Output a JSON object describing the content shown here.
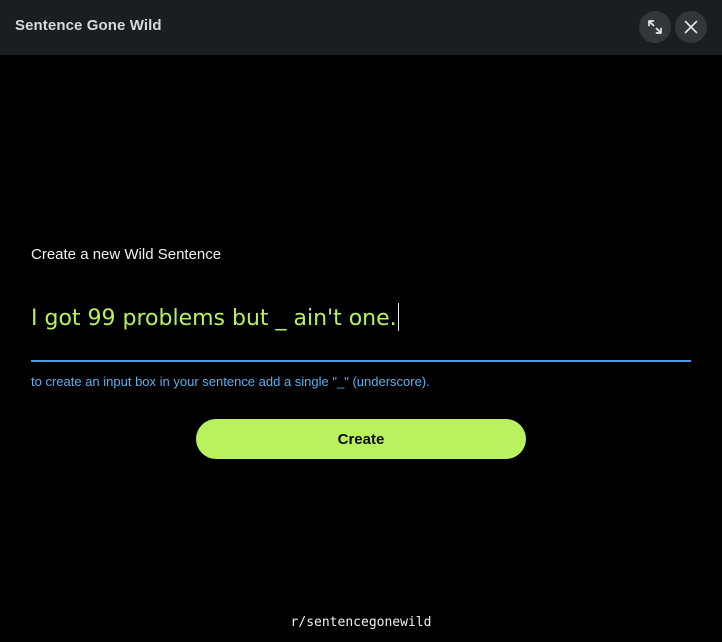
{
  "window": {
    "title": "Sentence Gone Wild",
    "expand_icon": "expand-icon",
    "close_icon": "close-icon"
  },
  "form": {
    "label": "Create a new Wild Sentence",
    "sentence_value": "I got 99 problems but _ ain't one.",
    "hint": "to create an input box in your sentence add a single \"_\" (underscore).",
    "create_label": "Create"
  },
  "footer": {
    "subreddit": "r/sentencegonewild"
  },
  "colors": {
    "accent_green": "#b9f25e",
    "sentence_green": "#b7f25b",
    "hint_blue": "#5ab0ee",
    "underline_blue": "#4a9be0",
    "titlebar_bg": "#1b1e21"
  }
}
